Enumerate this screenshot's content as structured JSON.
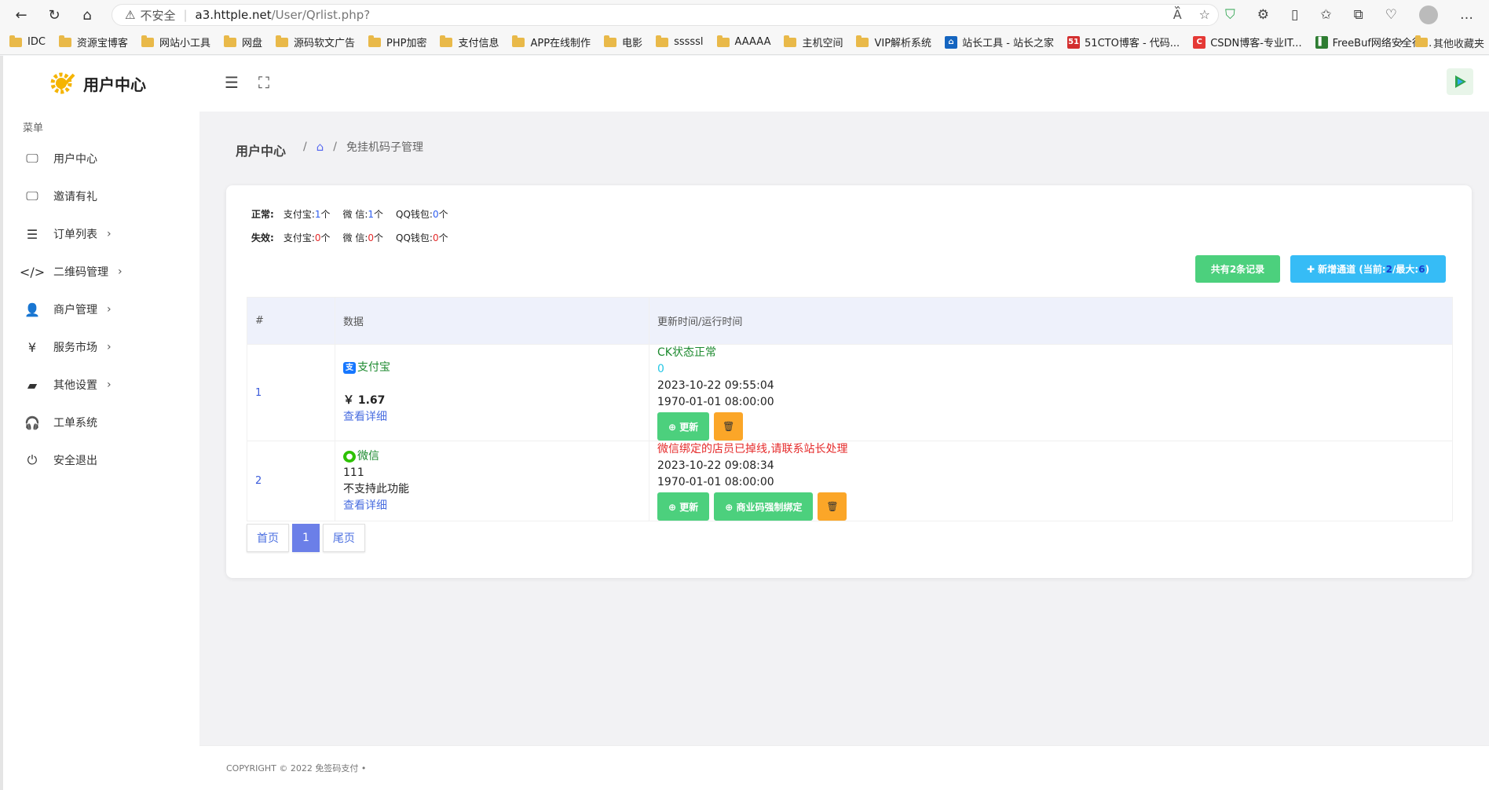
{
  "browser": {
    "insecure_label": "不安全",
    "url_host": "a3.httple.net",
    "url_path": "/User/Qrlist.php?"
  },
  "bookmarks": [
    {
      "label": "IDC",
      "type": "folder"
    },
    {
      "label": "资源宝博客",
      "type": "folder"
    },
    {
      "label": "网站小工具",
      "type": "folder"
    },
    {
      "label": "网盘",
      "type": "folder"
    },
    {
      "label": "源码软文广告",
      "type": "folder"
    },
    {
      "label": "PHP加密",
      "type": "folder"
    },
    {
      "label": "支付信息",
      "type": "folder"
    },
    {
      "label": "APP在线制作",
      "type": "folder"
    },
    {
      "label": "电影",
      "type": "folder"
    },
    {
      "label": "sssssl",
      "type": "folder"
    },
    {
      "label": "AAAAA",
      "type": "folder"
    },
    {
      "label": "主机空间",
      "type": "folder"
    },
    {
      "label": "VIP解析系统",
      "type": "folder"
    },
    {
      "label": "站长工具 - 站长之家",
      "type": "site"
    },
    {
      "label": "51CTO博客 - 代码...",
      "type": "site51"
    },
    {
      "label": "CSDN博客-专业IT...",
      "type": "csdn"
    },
    {
      "label": "FreeBuf网络安全行...",
      "type": "freebuf"
    }
  ],
  "bookmarks_other": "其他收藏夹",
  "sidebar": {
    "brand": "用户中心",
    "menu_title": "菜单",
    "items": [
      {
        "label": "用户中心",
        "icon": "monitor-icon",
        "chevron": false
      },
      {
        "label": "邀请有礼",
        "icon": "monitor-icon",
        "chevron": false
      },
      {
        "label": "订单列表",
        "icon": "list-icon",
        "chevron": true
      },
      {
        "label": "二维码管理",
        "icon": "code-icon",
        "chevron": true
      },
      {
        "label": "商户管理",
        "icon": "user-icon",
        "chevron": true
      },
      {
        "label": "服务市场",
        "icon": "yen-icon",
        "chevron": true
      },
      {
        "label": "其他设置",
        "icon": "wallet-icon",
        "chevron": true
      },
      {
        "label": "工单系统",
        "icon": "headset-icon",
        "chevron": false
      },
      {
        "label": "安全退出",
        "icon": "power-icon",
        "chevron": false
      }
    ]
  },
  "breadcrumb": {
    "title": "用户中心",
    "current": "免挂机码子管理"
  },
  "stats": {
    "normal_label": "正常:",
    "failed_label": "失效:",
    "alipay_label": "支付宝:",
    "wechat_label": "微 信:",
    "qq_label": "QQ钱包:",
    "unit": "个",
    "normal": {
      "alipay": "1",
      "wechat": "1",
      "qq": "0"
    },
    "failed": {
      "alipay": "0",
      "wechat": "0",
      "qq": "0"
    }
  },
  "actions": {
    "total_prefix": "共有 ",
    "total_count": "2",
    "total_suffix": " 条记录",
    "add_prefix": "✚ 新增通道 (当前: ",
    "add_current": "2",
    "add_mid": "/最大: ",
    "add_max": "6",
    "add_suffix": ")"
  },
  "table": {
    "headers": [
      "#",
      "数据",
      "更新时间/运行时间"
    ],
    "rows": [
      {
        "index": "1",
        "pay_name": "支付宝",
        "pay_icon": "alipay-icon",
        "amount": "￥ 1.67",
        "detail_link": "查看详细",
        "status": "CK状态正常",
        "count": "0",
        "updated": "2023-10-22 09:55:04",
        "runtime": "1970-01-01 08:00:00",
        "btn_update": "⊕ 更新",
        "btn_delete": "🗑"
      },
      {
        "index": "2",
        "pay_name": "微信",
        "pay_icon": "wechat-icon",
        "value": "111",
        "note": "不支持此功能",
        "detail_link": "查看详细",
        "status": "微信绑定的店员已掉线,请联系站长处理",
        "updated": "2023-10-22 09:08:34",
        "runtime": "1970-01-01 08:00:00",
        "btn_update": "⊕ 更新",
        "btn_bind": "⊕ 商业码强制绑定",
        "btn_delete": "🗑"
      }
    ]
  },
  "pager": {
    "first": "首页",
    "current": "1",
    "last": "尾页"
  },
  "footer": "COPYRIGHT © 2022 免签码支付 •"
}
